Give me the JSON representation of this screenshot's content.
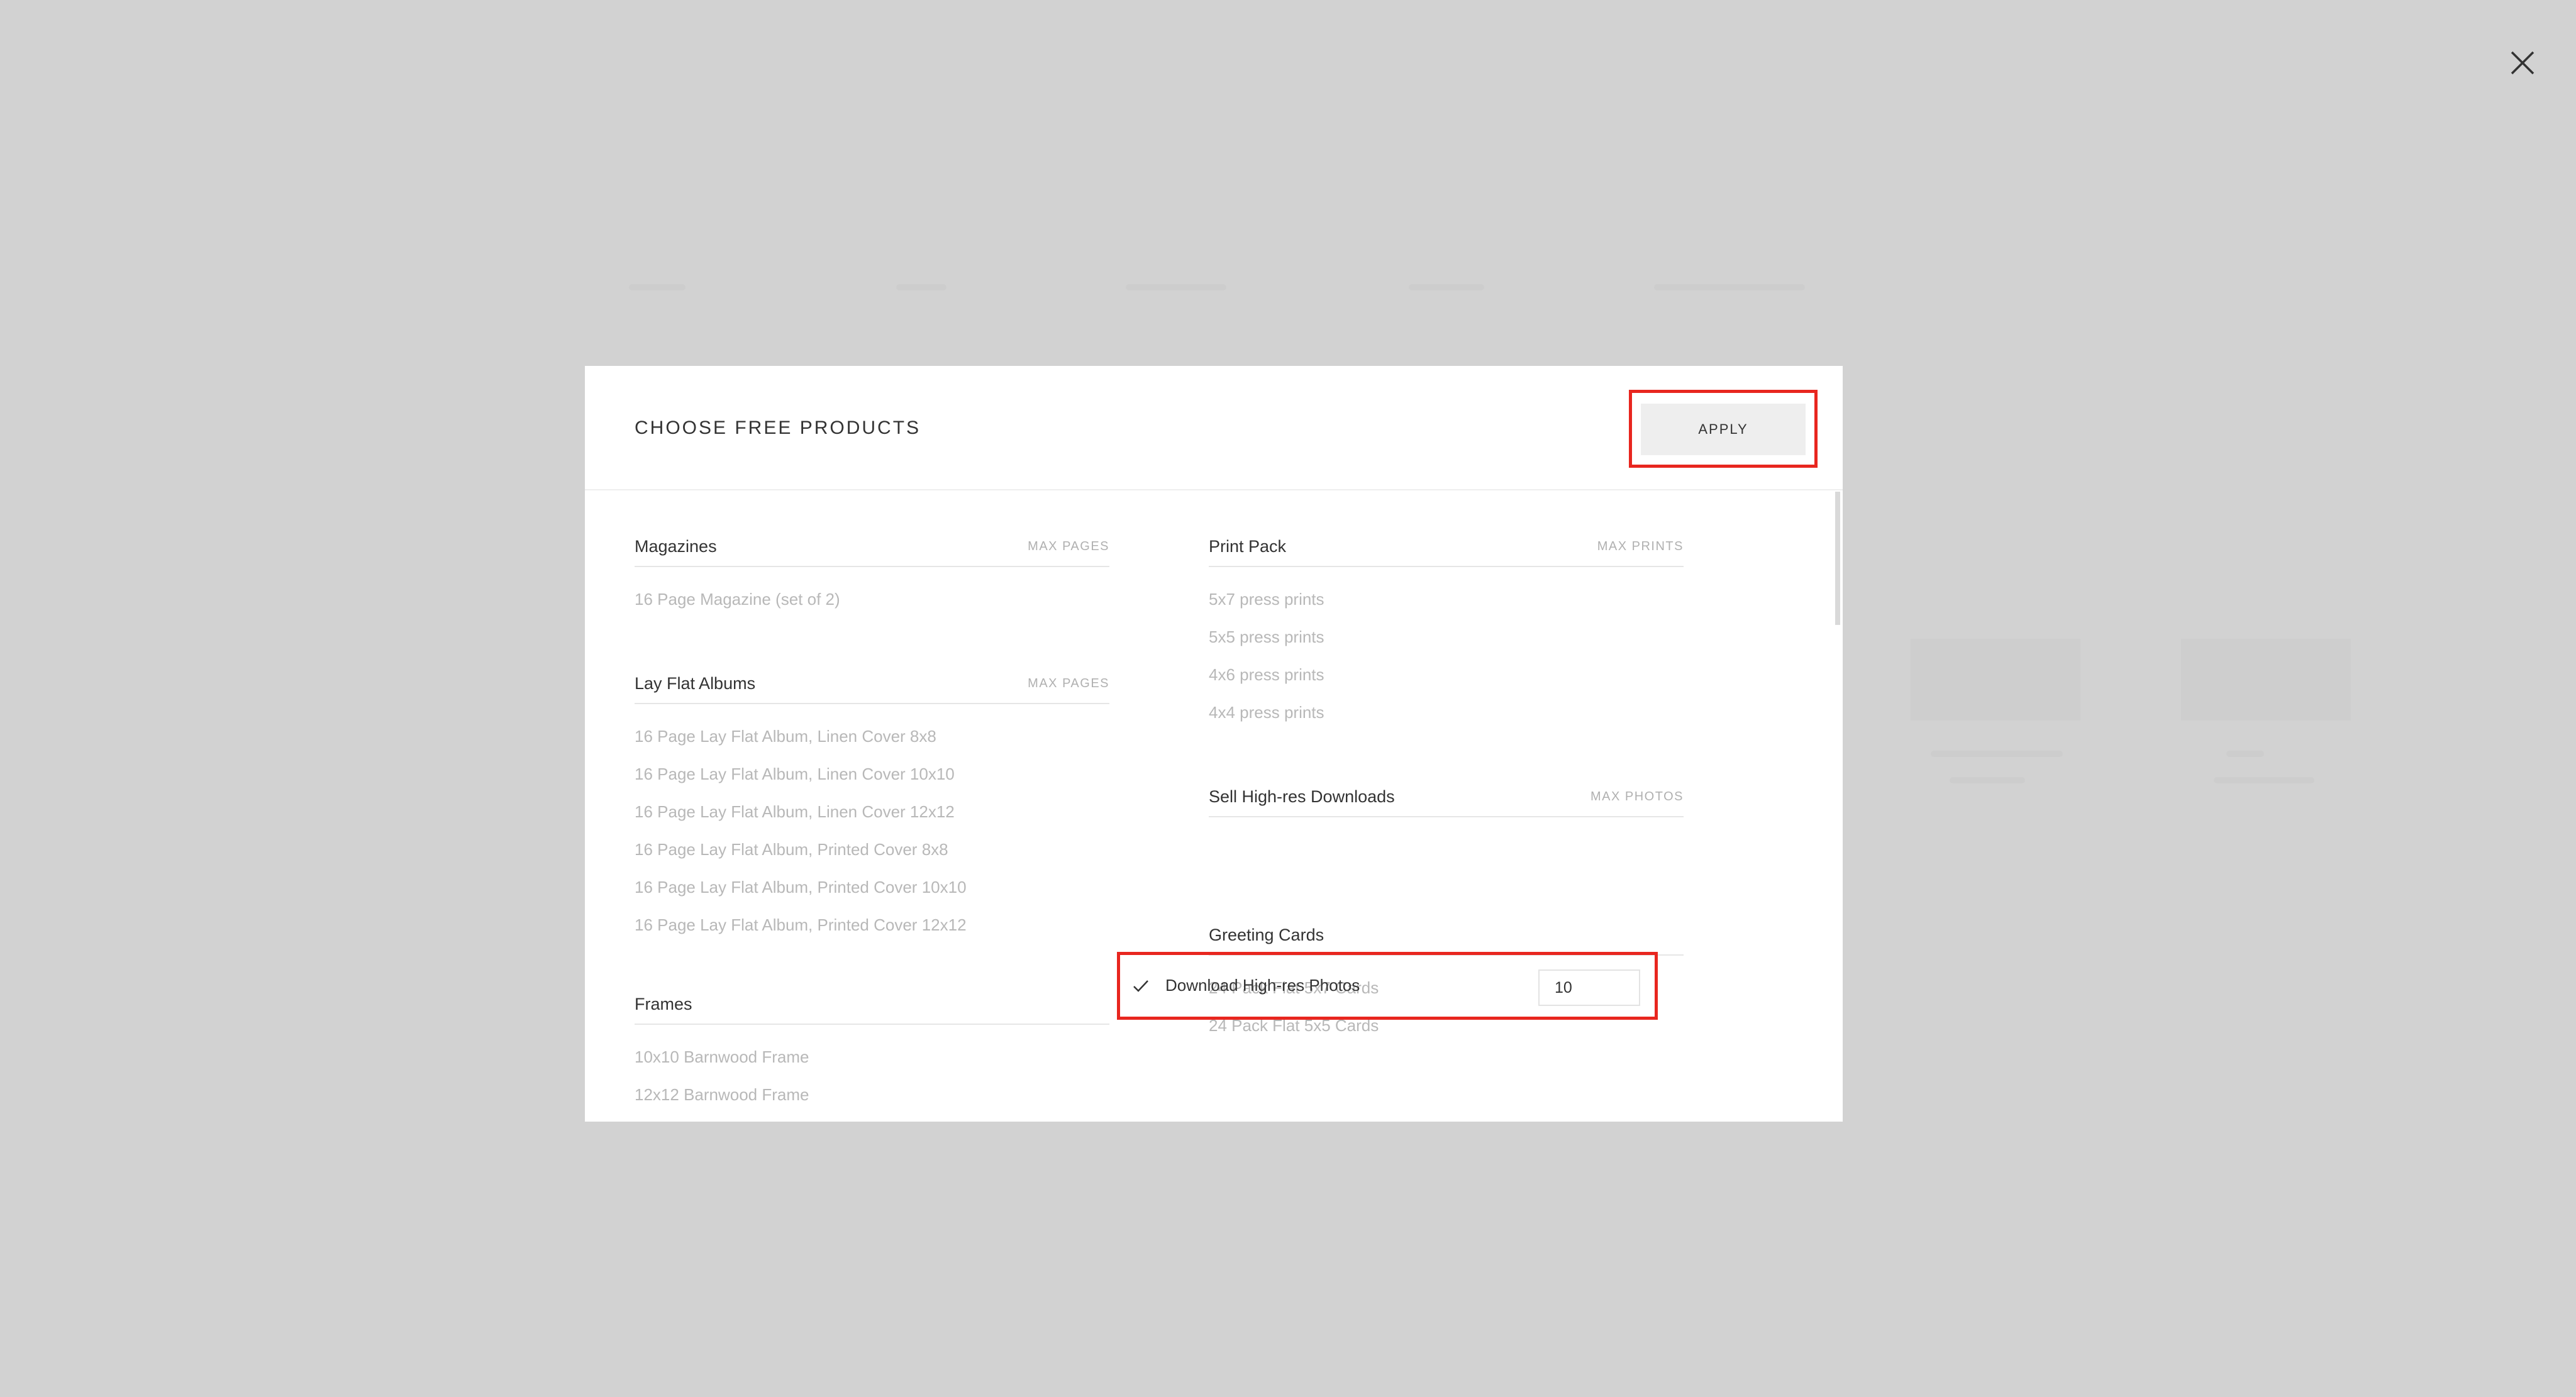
{
  "modal": {
    "title": "CHOOSE FREE PRODUCTS",
    "apply_label": "APPLY"
  },
  "left_column": [
    {
      "title": "Magazines",
      "meta": "MAX PAGES",
      "items": [
        "16 Page Magazine (set of 2)"
      ]
    },
    {
      "title": "Lay Flat Albums",
      "meta": "MAX PAGES",
      "items": [
        "16 Page Lay Flat Album, Linen Cover 8x8",
        "16 Page Lay Flat Album, Linen Cover 10x10",
        "16 Page Lay Flat Album, Linen Cover 12x12",
        "16 Page Lay Flat Album, Printed Cover 8x8",
        "16 Page Lay Flat Album, Printed Cover 10x10",
        "16 Page Lay Flat Album, Printed Cover 12x12"
      ]
    },
    {
      "title": "Frames",
      "meta": "",
      "items": [
        "10x10 Barnwood Frame",
        "12x12 Barnwood Frame"
      ]
    }
  ],
  "right_column": [
    {
      "title": "Print Pack",
      "meta": "MAX PRINTS",
      "items": [
        "5x7 press prints",
        "5x5 press prints",
        "4x6 press prints",
        "4x4 press prints"
      ]
    },
    {
      "title": "Sell High-res Downloads",
      "meta": "MAX PHOTOS",
      "selected_item": {
        "label": "Download High-res Photos",
        "value": "10",
        "checked": true
      }
    },
    {
      "title": "Greeting Cards",
      "meta": "",
      "items": [
        "24 Pack Flat 5x7 Cards",
        "24 Pack Flat 5x5 Cards"
      ]
    }
  ],
  "colors": {
    "backdrop": "#d2d2d2",
    "highlight": "#e8261f",
    "muted_text": "#b8b8b8",
    "button_bg": "#eeeeee"
  },
  "icons": {
    "close": "close-icon",
    "check": "check-icon"
  }
}
